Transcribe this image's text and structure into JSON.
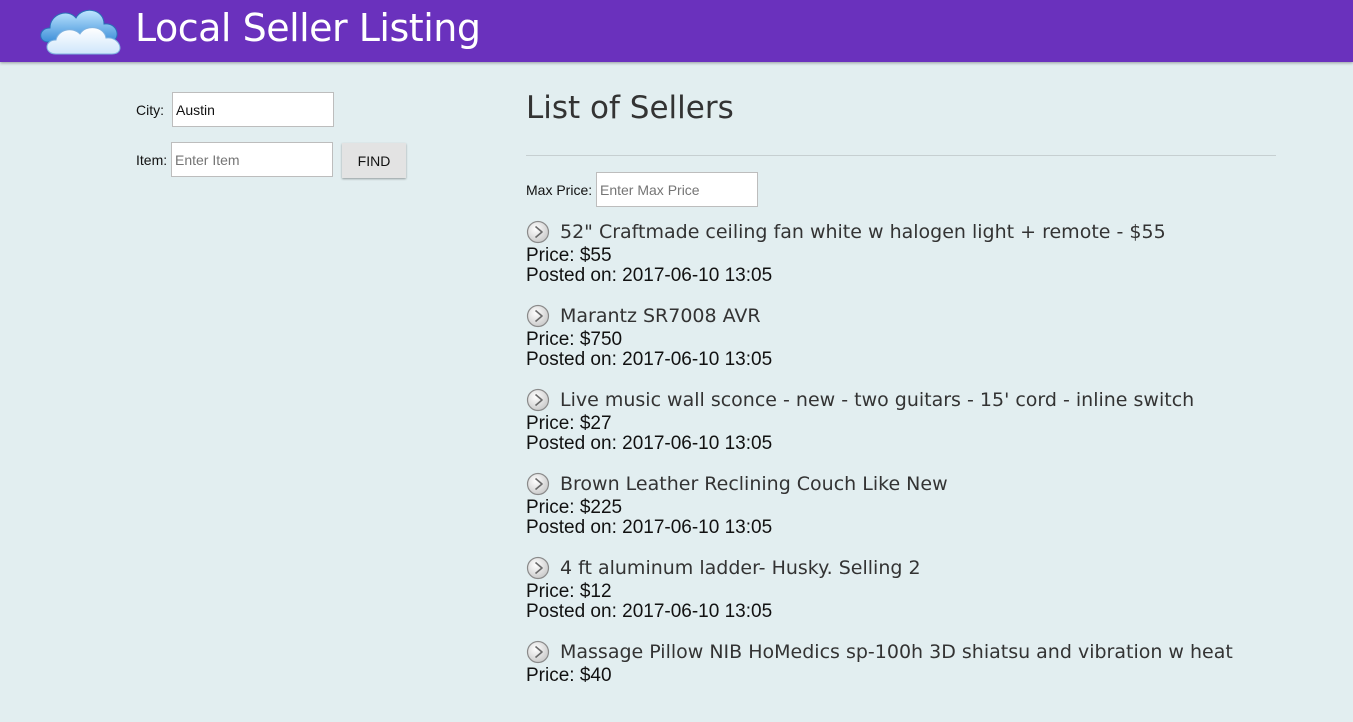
{
  "header": {
    "logo_icon": "cloud-icon",
    "title": "Local Seller Listing",
    "background_color": "#6a31bd"
  },
  "search": {
    "city_label": "City:",
    "city_value": "Austin",
    "item_label": "Item:",
    "item_placeholder": "Enter Item",
    "find_label": "FIND"
  },
  "main": {
    "title": "List of Sellers",
    "max_price_label": "Max Price:",
    "max_price_placeholder": "Enter Max Price",
    "listing_icon": "play-arrow-circle-icon",
    "listings": [
      {
        "title": "52\" Craftmade ceiling fan white w halogen light + remote - $55",
        "price": "Price: $55",
        "posted": "Posted on: 2017-06-10 13:05"
      },
      {
        "title": "Marantz SR7008 AVR",
        "price": "Price: $750",
        "posted": "Posted on: 2017-06-10 13:05"
      },
      {
        "title": "Live music wall sconce - new - two guitars - 15' cord - inline switch",
        "price": "Price: $27",
        "posted": "Posted on: 2017-06-10 13:05"
      },
      {
        "title": "Brown Leather Reclining Couch Like New",
        "price": "Price: $225",
        "posted": "Posted on: 2017-06-10 13:05"
      },
      {
        "title": "4 ft aluminum ladder- Husky. Selling 2",
        "price": "Price: $12",
        "posted": "Posted on: 2017-06-10 13:05"
      },
      {
        "title": "Massage Pillow NIB HoMedics sp-100h 3D shiatsu and vibration w heat",
        "price": "Price: $40",
        "posted": ""
      }
    ]
  }
}
